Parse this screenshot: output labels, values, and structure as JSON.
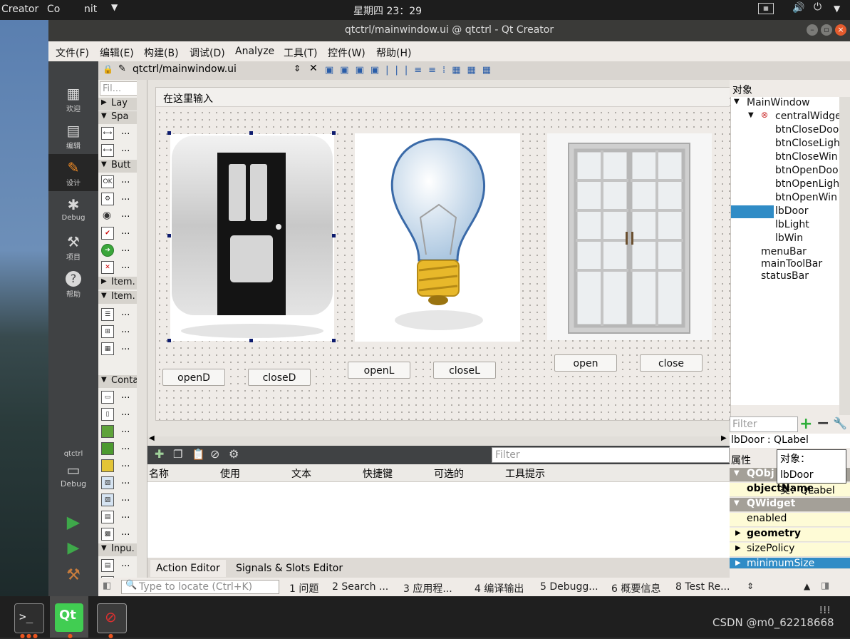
{
  "topbar": {
    "app": "Creator",
    "app2": "Co",
    "app3": "nit",
    "clock": "星期四 23：29"
  },
  "window": {
    "title": "qtctrl/mainwindow.ui @ qtctrl - Qt Creator"
  },
  "menu": [
    "文件(F)",
    "编辑(E)",
    "构建(B)",
    "调试(D)",
    "Analyze",
    "工具(T)",
    "控件(W)",
    "帮助(H)"
  ],
  "modes": [
    "欢迎",
    "编辑",
    "设计",
    "Debug",
    "项目",
    "帮助"
  ],
  "project": {
    "name": "qtctrl",
    "kit": "Debug"
  },
  "editor": {
    "file": "qtctrl/mainwindow.ui"
  },
  "widgetbox": {
    "filter": "Fil...",
    "categories": [
      "Lay",
      "Spa",
      "Butt",
      "Item.",
      "Item.",
      "Conta",
      "Inpu."
    ],
    "ellipsis": "..."
  },
  "form": {
    "menu_placeholder": "在这里输入",
    "buttons": [
      "openD",
      "closeD",
      "openL",
      "closeL",
      "open",
      "close"
    ]
  },
  "actioneditor": {
    "filter_placeholder": "Filter",
    "columns": [
      "名称",
      "使用",
      "文本",
      "快捷键",
      "可选的",
      "工具提示"
    ],
    "tabs": [
      "Action Editor",
      "Signals & Slots Editor"
    ]
  },
  "objectinspector": {
    "title": "对象",
    "tree": [
      "MainWindow",
      "centralWidge",
      "btnCloseDoo",
      "btnCloseLigh",
      "btnCloseWin",
      "btnOpenDoo",
      "btnOpenLigh",
      "btnOpenWin",
      "lbDoor",
      "lbLight",
      "lbWin",
      "menuBar",
      "mainToolBar",
      "statusBar"
    ]
  },
  "propertyeditor": {
    "filter_placeholder": "Filter",
    "selected": "lbDoor : QLabel",
    "title": "属性",
    "rows": [
      "QObj",
      "objectName",
      "QWidget",
      "enabled",
      "geometry",
      "sizePolicy",
      "minimumSize"
    ],
    "tooltip_obj": "对象：lbDoor",
    "tooltip_cls": "类：QLabel"
  },
  "statusbar": {
    "locator_placeholder": "Type to locate (Ctrl+K)",
    "panes": [
      "1 问题",
      "2 Search ...",
      "3 应用程...",
      "4 编译输出",
      "5 Debugg...",
      "6 概要信息",
      "8 Test Re..."
    ]
  },
  "watermark": "CSDN @m0_62218668",
  "colors": {
    "selection": "#308cc6",
    "modebar": "#404244",
    "green": "#2fae3a"
  }
}
